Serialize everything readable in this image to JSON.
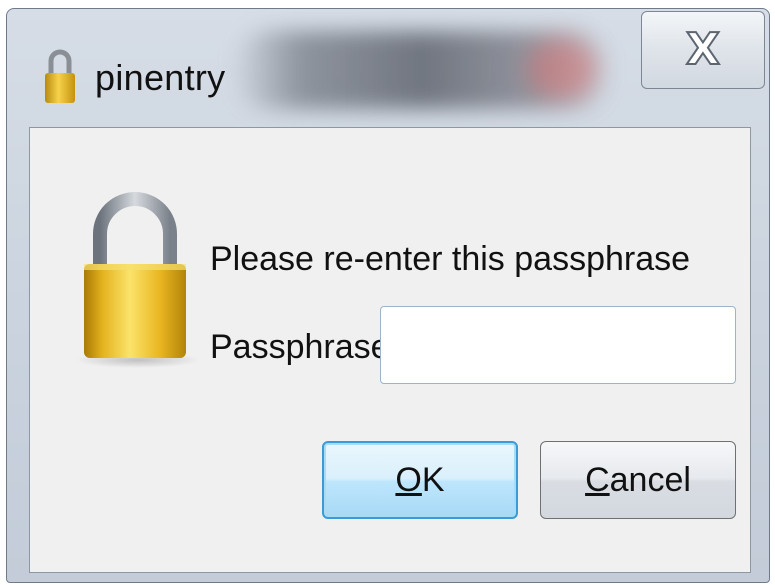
{
  "window": {
    "title": "pinentry",
    "close_glyph": "X"
  },
  "dialog": {
    "prompt": "Please re-enter this passphrase",
    "field_label": "Passphrase",
    "passphrase_value": "",
    "ok_mnemonic": "O",
    "ok_rest": "K",
    "cancel_mnemonic": "C",
    "cancel_rest": "ancel"
  },
  "icons": {
    "title": "padlock-icon",
    "main": "padlock-icon",
    "close": "close-icon"
  },
  "colors": {
    "lock_gold": "#e9b824",
    "ok_border": "#3c9bd6"
  }
}
